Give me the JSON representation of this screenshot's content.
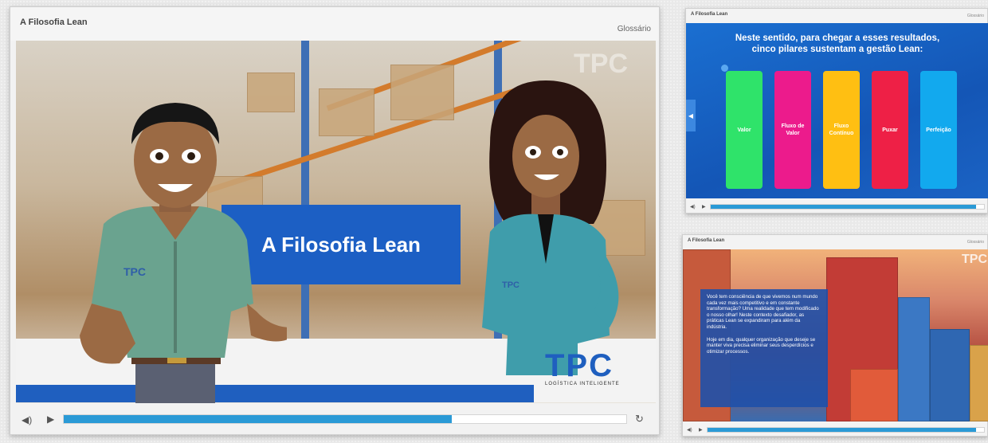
{
  "main_player": {
    "title": "A Filosofia Lean",
    "glossary_label": "Glossário",
    "banner_text": "A Filosofia Lean",
    "logo_text": "TPC",
    "logo_subtitle": "LOGÍSTICA INTELIGENTE",
    "shirt_logo_text": "TPC",
    "progress": 0.69
  },
  "thumb1": {
    "title": "A Filosofia Lean",
    "right_label": "Glossário",
    "heading_line1": "Neste sentido, para chegar a esses resultados,",
    "heading_line2": "cinco pilares sustentam a gestão Lean:",
    "pillars": [
      {
        "label": "Valor",
        "color": "#2fe36a"
      },
      {
        "label": "Fluxo de Valor",
        "color": "#ec1b8c"
      },
      {
        "label": "Fluxo Contínuo",
        "color": "#ffbf12"
      },
      {
        "label": "Puxar",
        "color": "#ee2046"
      },
      {
        "label": "Perfeição",
        "color": "#12a9ee"
      }
    ],
    "progress": 0.97
  },
  "thumb2": {
    "title": "A Filosofia Lean",
    "right_label": "Glossário",
    "logo_text": "TPC",
    "paragraph1": "Você tem consciência de que vivemos num mundo cada vez mais competitivo e em constante transformação? Uma realidade que tem modificado o nosso olhar! Neste contexto desafiador, as práticas Lean se expandiram para além da indústria.",
    "paragraph2": "Hoje em dia, qualquer organização que deseje se manter viva precisa eliminar seus desperdícios e otimizar processos.",
    "progress": 0.97
  },
  "colors": {
    "accent_blue": "#1f5fbf",
    "progress_blue": "#2a9ad6"
  }
}
